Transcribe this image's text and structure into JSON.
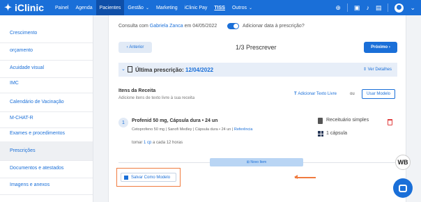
{
  "app": {
    "name": "iClinic",
    "logo_icon": "hexagon-logo-icon"
  },
  "nav": {
    "items": [
      {
        "label": "Painel",
        "active": false
      },
      {
        "label": "Agenda",
        "active": false
      },
      {
        "label": "Pacientes",
        "active": true
      },
      {
        "label": "Gestão",
        "active": false,
        "caret": "⌄"
      },
      {
        "label": "Marketing",
        "active": false
      },
      {
        "label": "iClinic Pay",
        "active": false
      },
      {
        "label": "TISS",
        "active": false
      },
      {
        "label": "Outros",
        "active": false,
        "caret": "⌄"
      }
    ],
    "icons": [
      "plus-circle-icon",
      "gift-icon",
      "bell-icon",
      "chat-icon",
      "user-avatar-icon"
    ]
  },
  "sidebar": {
    "items": [
      {
        "label": "Crescimento",
        "active": false
      },
      {
        "label": "orçamento",
        "active": false
      },
      {
        "label": "Acuidade visual",
        "active": false
      },
      {
        "label": "IMC",
        "active": false
      },
      {
        "label": "Calendário de Vacinação",
        "active": false
      },
      {
        "label": "M-CHAT-R",
        "active": false
      },
      {
        "label": "Exames e procedimentos",
        "active": false
      },
      {
        "label": "Prescrições",
        "active": true
      },
      {
        "label": "Documentos e atestados",
        "active": false
      },
      {
        "label": "Imagens e anexos",
        "active": false
      }
    ]
  },
  "consult": {
    "prefix": "Consulta com",
    "doctor": "Gabriela Zanca",
    "on": "em",
    "date": "04/05/2022",
    "toggle_label": "Adicionar data à prescrição?",
    "toggle_on": true
  },
  "stepper": {
    "prev_label": "Anterior",
    "title": "1/3 Prescrever",
    "next_label": "Próximo"
  },
  "last_prescription": {
    "label": "Última prescrição:",
    "date": "12/04/2022",
    "details_label": "Ver Detalhes"
  },
  "items": {
    "title": "Itens da Receita",
    "subtitle": "Adicione itens de texto livre à sua receita",
    "add_free_text": "Adicionar Texto Livre",
    "or": "ou",
    "use_model": "Usar Modelo"
  },
  "prescription_item": {
    "number": "1",
    "name": "Profenid 50 mg, Cápsula dura • 24 un",
    "detail": "Cetoprofeno 50 mg | Sanofi Medley | Cápsula dura • 24 un | ",
    "reference": "Referência",
    "dose_prefix": "tomar",
    "dose_qty": "1 cp",
    "dose_suffix": "a cada 12 horas",
    "type": "Receituário simples",
    "quantity": "1 cápsula"
  },
  "new_item_label": "Novo Item",
  "save_model_label": "Salvar Como Modelo",
  "badge_label": "WB",
  "colors": {
    "accent": "#1a6fd8",
    "highlight": "#f07b3f",
    "danger": "#e04040"
  }
}
